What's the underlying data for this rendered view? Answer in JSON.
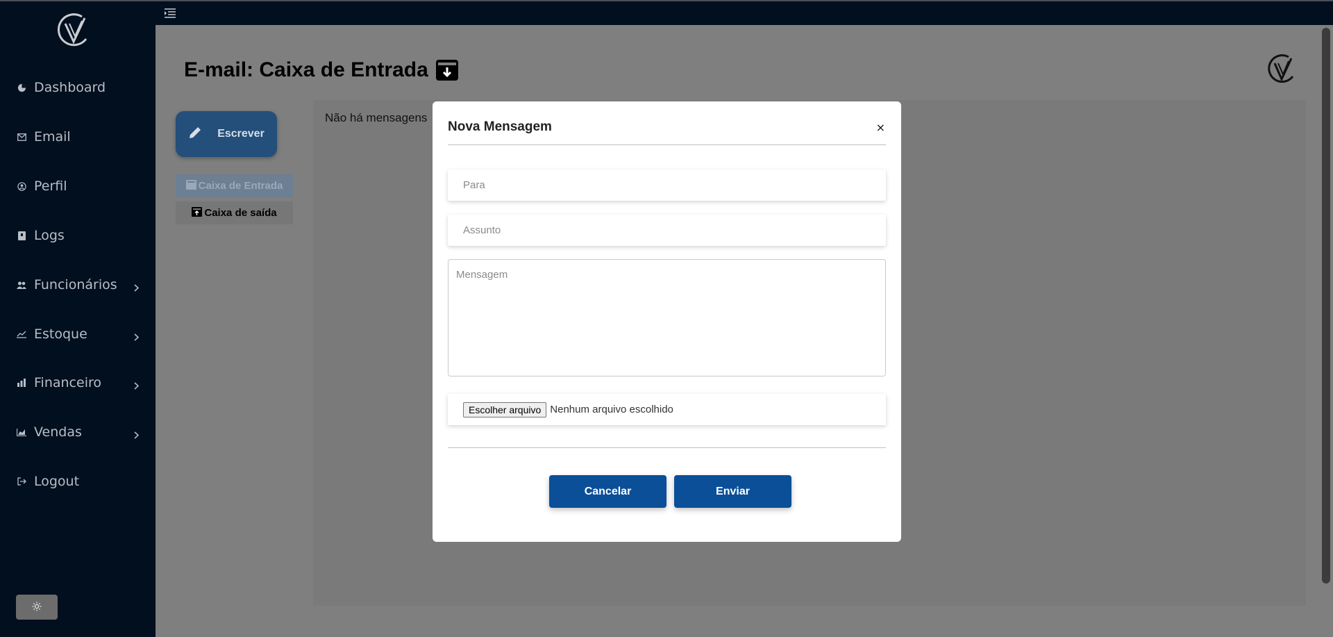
{
  "sidebar": {
    "items": [
      {
        "label": "Dashboard",
        "icon": "dashboard-icon"
      },
      {
        "label": "Email",
        "icon": "mail-icon"
      },
      {
        "label": "Perfil",
        "icon": "user-circle-icon"
      },
      {
        "label": "Logs",
        "icon": "book-icon"
      },
      {
        "label": "Funcionários",
        "icon": "users-icon"
      },
      {
        "label": "Estoque",
        "icon": "chart-line-icon"
      },
      {
        "label": "Financeiro",
        "icon": "finance-icon"
      },
      {
        "label": "Vendas",
        "icon": "bar-chart-icon"
      },
      {
        "label": "Logout",
        "icon": "logout-icon"
      }
    ],
    "theme_icon": "sun-icon"
  },
  "page": {
    "title": "E-mail: Caixa de Entrada",
    "empty_text": "Não há mensagens",
    "compose_label": "Escrever",
    "folders": {
      "inbox": "Caixa de Entrada",
      "outbox": "Caixa de saída"
    }
  },
  "modal": {
    "title": "Nova Mensagem",
    "close_label": "×",
    "to_placeholder": "Para",
    "subject_placeholder": "Assunto",
    "message_placeholder": "Mensagem",
    "file_button": "Escolher arquivo",
    "file_status": "Nenhum arquivo escolhido",
    "cancel_label": "Cancelar",
    "send_label": "Enviar"
  },
  "colors": {
    "sidebar_bg": "#010f1e",
    "primary_button": "#0a4f98",
    "overlay": "#7f7f7f"
  }
}
